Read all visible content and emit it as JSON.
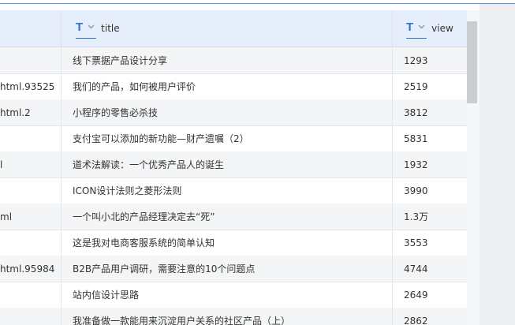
{
  "table": {
    "columns": {
      "title": {
        "type_icon": "T",
        "label": "title"
      },
      "view": {
        "type_icon": "T",
        "label": "view"
      }
    },
    "rows": [
      {
        "url": "",
        "title": "线下票据产品设计分享",
        "view": "1293"
      },
      {
        "url": "93525.html",
        "title": "我们的产品，如何被用户评价",
        "view": "2519"
      },
      {
        "url": "2.html",
        "title": "小程序的零售必杀技",
        "view": "3812"
      },
      {
        "url": "",
        "title": "支付宝可以添加的新功能—财产遗嘱（2）",
        "view": "5831"
      },
      {
        "url": "l",
        "title": "道术法解读：一个优秀产品人的诞生",
        "view": "1932"
      },
      {
        "url": "",
        "title": "ICON设计法则之菱形法则",
        "view": "3990"
      },
      {
        "url": "ml",
        "title": "一个叫小北的产品经理决定去“死”",
        "view": "1.3万"
      },
      {
        "url": "",
        "title": "这是我对电商客服系统的简单认知",
        "view": "3553"
      },
      {
        "url": "95984.html",
        "title": "B2B产品用户调研，需要注意的10个问题点",
        "view": "4744"
      },
      {
        "url": "",
        "title": "站内信设计思路",
        "view": "2649"
      },
      {
        "url": "",
        "title": "我准备做一款能用来沉淀用户关系的社区产品（上）",
        "view": "2862"
      }
    ]
  }
}
